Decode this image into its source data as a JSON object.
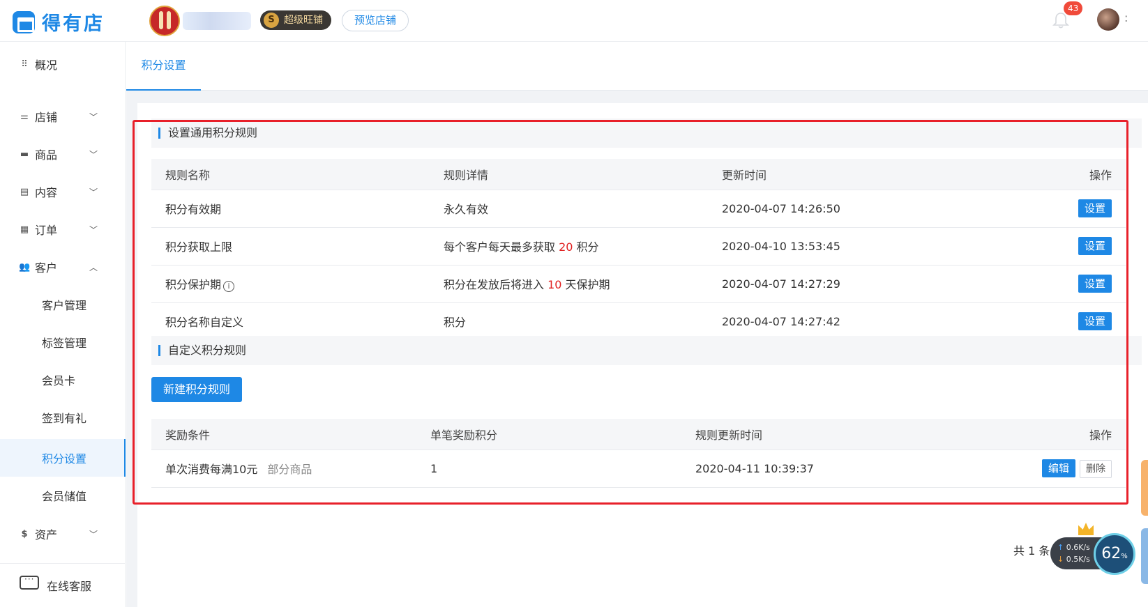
{
  "header": {
    "logo_text": "得有店",
    "badge_super": "超级旺铺",
    "badge_coin": "S",
    "preview_button": "预览店铺",
    "notification_count": "43",
    "user_more": ":"
  },
  "sidebar": {
    "overview": "概况",
    "groups": [
      {
        "label": "店铺"
      },
      {
        "label": "商品"
      },
      {
        "label": "内容"
      },
      {
        "label": "订单"
      },
      {
        "label": "客户"
      },
      {
        "label": "资产"
      }
    ],
    "customer_sub": [
      "客户管理",
      "标签管理",
      "会员卡",
      "签到有礼",
      "积分设置",
      "会员储值"
    ],
    "service": "在线客服"
  },
  "tabs": [
    "积分设置"
  ],
  "general_rules": {
    "section_title": "设置通用积分规则",
    "columns": [
      "规则名称",
      "规则详情",
      "更新时间",
      "操作"
    ],
    "rows": [
      {
        "name": "积分有效期",
        "detail_pre": "永久有效",
        "detail_num": "",
        "detail_post": "",
        "time": "2020-04-07 14:26:50",
        "action": "设置"
      },
      {
        "name": "积分获取上限",
        "detail_pre": "每个客户每天最多获取 ",
        "detail_num": "20",
        "detail_post": " 积分",
        "time": "2020-04-10 13:53:45",
        "action": "设置"
      },
      {
        "name": "积分保护期",
        "detail_pre": "积分在发放后将进入 ",
        "detail_num": "10",
        "detail_post": " 天保护期",
        "time": "2020-04-07 14:27:29",
        "action": "设置"
      },
      {
        "name": "积分名称自定义",
        "detail_pre": "积分",
        "detail_num": "",
        "detail_post": "",
        "time": "2020-04-07 14:27:42",
        "action": "设置"
      }
    ]
  },
  "custom_rules": {
    "section_title": "自定义积分规则",
    "new_button": "新建积分规则",
    "columns": [
      "奖励条件",
      "单笔奖励积分",
      "规则更新时间",
      "操作"
    ],
    "rows": [
      {
        "condition": "单次消费每满10元",
        "scope": "部分商品",
        "points": "1",
        "time": "2020-04-11 10:39:37",
        "edit": "编辑",
        "delete": "删除"
      }
    ]
  },
  "pager": {
    "total": "共 1 条"
  },
  "speed_widget": {
    "up": "0.6K/s",
    "down": "0.5K/s",
    "percent": "62",
    "unit": "%"
  }
}
